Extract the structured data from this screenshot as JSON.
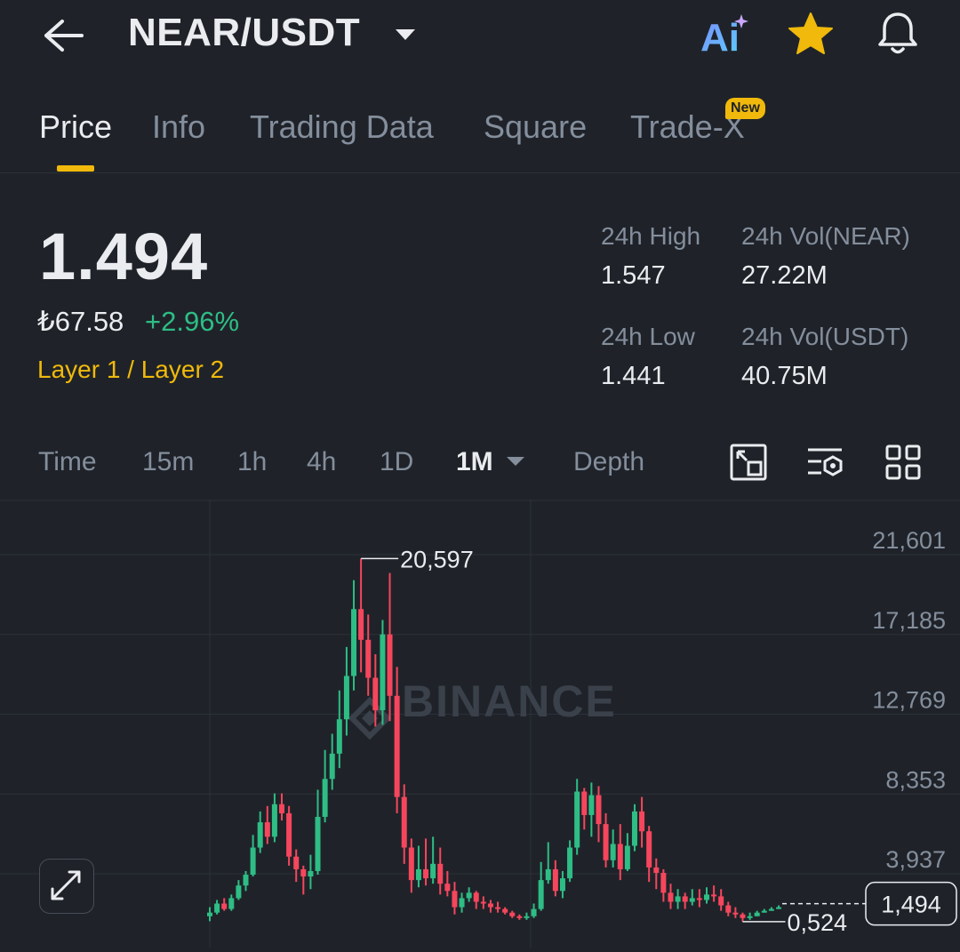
{
  "header": {
    "pair": "NEAR/USDT",
    "ai_label": "Ai"
  },
  "tabs": [
    {
      "label": "Price",
      "active": true
    },
    {
      "label": "Info"
    },
    {
      "label": "Trading Data"
    },
    {
      "label": "Square"
    },
    {
      "label": "Trade-X",
      "badge": "New"
    }
  ],
  "price": {
    "last": "1.494",
    "fiat": "₺67.58",
    "change": "+2.96%",
    "sector": "Layer 1 / Layer 2"
  },
  "stats": {
    "high_label": "24h High",
    "high": "1.547",
    "vol_base_label": "24h Vol(NEAR)",
    "vol_base": "27.22M",
    "low_label": "24h Low",
    "low": "1.441",
    "vol_quote_label": "24h Vol(USDT)",
    "vol_quote": "40.75M"
  },
  "intervals": [
    "Time",
    "15m",
    "1h",
    "4h",
    "1D",
    "1M",
    "Depth"
  ],
  "active_interval": "1M",
  "colors": {
    "up": "#2ebd85",
    "down": "#f6465d",
    "accent": "#f0b90b",
    "bg": "#1f2329"
  },
  "chart_data": {
    "type": "candlestick",
    "watermark": "BINANCE",
    "y_ticks": [
      "21,601",
      "17,185",
      "12,769",
      "8,353",
      "3,937"
    ],
    "y_tick_values": [
      21.601,
      17.185,
      12.769,
      8.353,
      3.937
    ],
    "max_label": "20,597",
    "min_label": "0,524",
    "current_price_label": "1,494",
    "current_price": 1.494,
    "candles": [
      [
        0.8,
        1.0,
        1.3,
        0.524
      ],
      [
        1.0,
        1.5,
        1.7,
        0.9
      ],
      [
        1.5,
        1.2,
        1.8,
        1.1
      ],
      [
        1.2,
        1.8,
        2.0,
        1.1
      ],
      [
        1.8,
        2.5,
        2.8,
        1.7
      ],
      [
        2.5,
        3.1,
        3.3,
        2.2
      ],
      [
        3.1,
        4.6,
        5.3,
        3.0
      ],
      [
        4.6,
        6.0,
        6.6,
        4.3
      ],
      [
        6.0,
        5.2,
        6.9,
        4.8
      ],
      [
        5.2,
        7.0,
        7.6,
        4.9
      ],
      [
        7.0,
        6.5,
        7.6,
        6.1
      ],
      [
        6.5,
        4.1,
        6.9,
        3.6
      ],
      [
        4.1,
        3.4,
        4.5,
        2.7
      ],
      [
        3.4,
        3.0,
        3.6,
        2.0
      ],
      [
        3.0,
        3.3,
        4.2,
        2.3
      ],
      [
        3.3,
        6.3,
        7.8,
        3.1
      ],
      [
        6.3,
        8.4,
        10.0,
        6.0
      ],
      [
        8.4,
        9.8,
        10.9,
        7.8
      ],
      [
        9.8,
        11.7,
        13.3,
        9.0
      ],
      [
        11.7,
        14.1,
        15.7,
        10.8
      ],
      [
        14.1,
        17.8,
        19.4,
        13.3
      ],
      [
        17.8,
        16.1,
        20.597,
        14.3
      ],
      [
        16.1,
        14.0,
        17.5,
        13.0
      ],
      [
        14.0,
        12.2,
        15.3,
        11.3
      ],
      [
        12.2,
        16.4,
        17.2,
        11.4
      ],
      [
        16.4,
        13.0,
        19.8,
        11.6
      ],
      [
        13.0,
        7.4,
        14.6,
        6.5
      ],
      [
        7.4,
        4.6,
        8.1,
        3.7
      ],
      [
        4.6,
        2.8,
        5.1,
        2.1
      ],
      [
        2.8,
        3.4,
        4.7,
        2.4
      ],
      [
        3.4,
        2.9,
        5.1,
        2.5
      ],
      [
        2.9,
        3.7,
        5.2,
        2.6
      ],
      [
        3.7,
        2.6,
        4.6,
        2.0
      ],
      [
        2.6,
        2.2,
        3.3,
        1.9
      ],
      [
        2.2,
        1.3,
        2.7,
        0.9
      ],
      [
        1.3,
        1.8,
        2.1,
        1.0
      ],
      [
        1.8,
        2.1,
        2.4,
        1.6
      ],
      [
        2.1,
        1.6,
        2.2,
        1.2
      ],
      [
        1.6,
        1.5,
        1.9,
        1.2
      ],
      [
        1.5,
        1.3,
        1.7,
        1.0
      ],
      [
        1.3,
        1.2,
        1.6,
        1.0
      ],
      [
        1.2,
        1.0,
        1.3,
        0.9
      ],
      [
        1.0,
        0.8,
        1.1,
        0.7
      ],
      [
        0.8,
        0.7,
        0.9,
        0.6
      ],
      [
        0.7,
        0.8,
        1.0,
        0.6
      ],
      [
        0.8,
        1.2,
        1.5,
        0.7
      ],
      [
        1.2,
        2.8,
        3.8,
        1.1
      ],
      [
        2.8,
        3.4,
        4.9,
        2.6
      ],
      [
        3.4,
        2.2,
        3.9,
        1.9
      ],
      [
        2.2,
        2.9,
        3.3,
        1.8
      ],
      [
        2.9,
        4.6,
        5.0,
        2.7
      ],
      [
        4.6,
        7.7,
        8.4,
        4.2
      ],
      [
        7.7,
        6.4,
        7.9,
        5.6
      ],
      [
        6.4,
        7.5,
        8.2,
        5.2
      ],
      [
        7.5,
        5.9,
        8.0,
        4.9
      ],
      [
        5.9,
        3.9,
        6.5,
        3.5
      ],
      [
        3.9,
        4.8,
        5.6,
        3.5
      ],
      [
        4.8,
        3.4,
        5.9,
        2.8
      ],
      [
        3.4,
        4.7,
        5.4,
        3.3
      ],
      [
        4.7,
        6.6,
        7.0,
        4.4
      ],
      [
        6.6,
        5.5,
        7.4,
        4.6
      ],
      [
        5.5,
        3.5,
        5.8,
        2.7
      ],
      [
        3.5,
        3.2,
        4.0,
        2.3
      ],
      [
        3.2,
        2.1,
        3.4,
        1.6
      ],
      [
        2.1,
        1.6,
        2.6,
        1.2
      ],
      [
        1.6,
        1.9,
        2.3,
        1.2
      ],
      [
        1.9,
        1.6,
        2.1,
        1.2
      ],
      [
        1.6,
        1.8,
        2.3,
        1.4
      ],
      [
        1.8,
        1.7,
        2.3,
        1.3
      ],
      [
        1.7,
        2.0,
        2.4,
        1.5
      ],
      [
        2.0,
        1.9,
        2.5,
        1.6
      ],
      [
        1.9,
        1.4,
        2.3,
        1.1
      ],
      [
        1.4,
        1.0,
        1.6,
        0.8
      ],
      [
        1.0,
        0.9,
        1.3,
        0.7
      ],
      [
        0.9,
        0.7,
        1.0,
        0.5
      ],
      [
        0.7,
        0.8,
        1.0,
        0.6
      ],
      [
        0.8,
        1.0,
        1.1,
        0.8
      ],
      [
        1.0,
        1.1,
        1.2,
        1.0
      ],
      [
        1.1,
        1.2,
        1.3,
        1.1
      ],
      [
        1.2,
        1.3,
        1.4,
        1.2
      ]
    ]
  }
}
